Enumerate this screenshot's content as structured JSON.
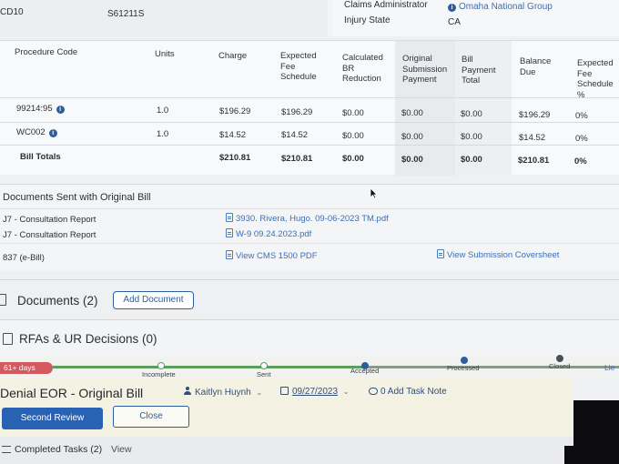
{
  "header": {
    "left_code": "CD10",
    "left_value": "S61211S",
    "claims_admin_label": "Claims Administrator",
    "claims_admin_value": "Omaha National Group",
    "injury_state_label": "Injury State",
    "injury_state_value": "CA"
  },
  "procedure_table": {
    "columns": [
      "Procedure Code",
      "Units",
      "Charge",
      "Expected Fee Schedule",
      "Calculated BR Reduction",
      "Original Submission Payment",
      "Bill Payment Total",
      "Balance Due",
      "Expected Fee Schedule %"
    ],
    "rows": [
      {
        "code": "99214:95",
        "units": "1.0",
        "charge": "$196.29",
        "expected": "$196.29",
        "br": "$0.00",
        "original": "$0.00",
        "payment": "$0.00",
        "balance": "$196.29",
        "pct": "0%"
      },
      {
        "code": "WC002",
        "units": "1.0",
        "charge": "$14.52",
        "expected": "$14.52",
        "br": "$0.00",
        "original": "$0.00",
        "payment": "$0.00",
        "balance": "$14.52",
        "pct": "0%"
      }
    ],
    "totals": {
      "label": "Bill Totals",
      "charge": "$210.81",
      "expected": "$210.81",
      "br": "$0.00",
      "original": "$0.00",
      "payment": "$0.00",
      "balance": "$210.81",
      "pct": "0%"
    }
  },
  "documents_sent": {
    "title": "Documents Sent with Original Bill",
    "items": [
      {
        "label": "J7 - Consultation Report",
        "file": "3930. Rivera, Hugo. 09-06-2023 TM.pdf"
      },
      {
        "label": "J7 - Consultation Report",
        "file": "W-9 09.24.2023.pdf"
      }
    ],
    "ebill": {
      "label": "837 (e-Bill)",
      "view_cms": "View CMS 1500 PDF",
      "view_coversheet": "View Submission Coversheet"
    }
  },
  "documents_section": {
    "title": "Documents (2)",
    "add_button": "Add Document"
  },
  "rfa_section": {
    "title": "RFAs & UR Decisions (0)"
  },
  "timeline": {
    "days_badge": "61+ days",
    "steps": [
      "Incomplete",
      "Sent",
      "Accepted",
      "Processed",
      "Closed",
      "Lie"
    ]
  },
  "denial": {
    "title": "Denial EOR - Original Bill",
    "assignee": "Kaitlyn Huynh",
    "date": "09/27/2023",
    "task_count": "0",
    "add_task": "Add Task Note",
    "second_review": "Second Review",
    "close": "Close"
  },
  "footer": {
    "completed_tasks": "Completed Tasks (2)",
    "view": "View"
  },
  "colors": {
    "accent": "#2a62b3",
    "badge_red": "#d25a5f",
    "progress_green": "#5a9d5c"
  }
}
